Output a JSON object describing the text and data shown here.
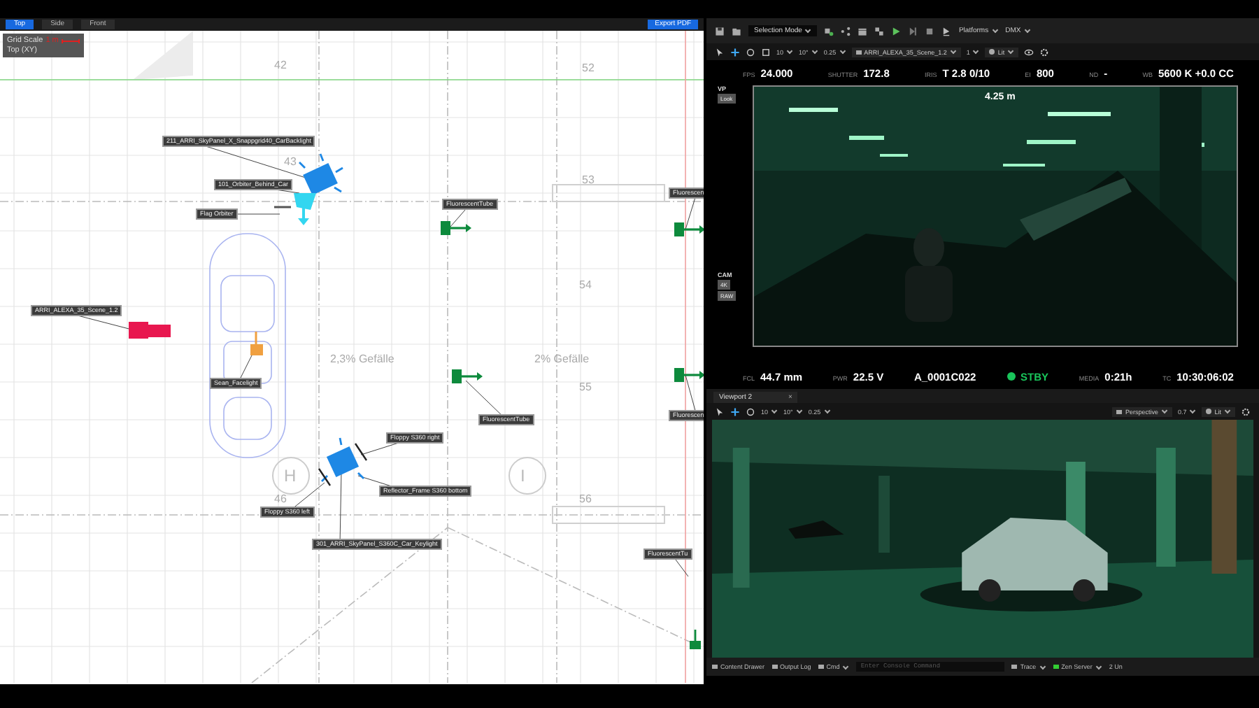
{
  "plan_view": {
    "tabs": [
      {
        "label": "Top",
        "selected": true
      },
      {
        "label": "Side",
        "selected": false
      },
      {
        "label": "Front",
        "selected": false
      }
    ],
    "export_button": "Export PDF",
    "grid_scale": {
      "label": "Grid Scale",
      "value": "1 m",
      "view": "Top (XY)"
    },
    "labels": [
      "211_ARRI_SkyPanel_X_Snappgrid40_CarBacklight",
      "101_Orbiter_Behind_Car",
      "Flag Orbiter",
      "FluorescentTube",
      "Fluorescen",
      "ARRI_ALEXA_35_Scene_1.2",
      "Sean_Facelight",
      "FluorescentTube",
      "Fluorescen",
      "Floppy S360 right",
      "Reflector_Frame S360 bottom",
      "Floppy S360 left",
      "301_ARRI_SkyPanel_S360C_Car_Keylight",
      "FluorescentTu"
    ],
    "plan_texts": [
      "52",
      "53",
      "54",
      "55",
      "56",
      "42",
      "43",
      "46",
      "2,3% Gefälle",
      "2% Gefälle"
    ],
    "axis_marks": [
      "H",
      "I"
    ]
  },
  "toolbar": {
    "mode": "Selection Mode",
    "platforms": "Platforms",
    "dmx": "DMX"
  },
  "viewport_1": {
    "camera": "ARRI_ALEXA_35_Scene_1.2",
    "snap_values": [
      "10",
      "10°",
      "0.25"
    ],
    "lit": "Lit",
    "layout": "1"
  },
  "camera_hud": {
    "top": [
      {
        "label": "FPS",
        "value": "24.000"
      },
      {
        "label": "SHUTTER",
        "value": "172.8"
      },
      {
        "label": "IRIS",
        "value": "T 2.8  0/10"
      },
      {
        "label": "EI",
        "value": "800"
      },
      {
        "label": "ND",
        "value": "-"
      },
      {
        "label": "WB",
        "value": "5600 K +0.0 CC"
      }
    ],
    "side": [
      {
        "heading": "VP",
        "buttons": [
          "Look"
        ]
      },
      {
        "heading": "CAM",
        "buttons": [
          "4K",
          "RAW"
        ]
      }
    ],
    "distance": "4.25 m",
    "bottom": [
      {
        "kind": "reading",
        "label": "FCL",
        "value": "44.7 mm"
      },
      {
        "kind": "reading",
        "label": "PWR",
        "value": "22.5 V"
      },
      {
        "kind": "clip",
        "value": "A_0001C022"
      },
      {
        "kind": "status",
        "value": "STBY"
      },
      {
        "kind": "reading",
        "label": "MEDIA",
        "value": "0:21h"
      },
      {
        "kind": "reading",
        "label": "TC",
        "value": "10:30:06:02"
      }
    ]
  },
  "viewport_2": {
    "tab": "Viewport 2",
    "close": "×",
    "snap_values": [
      "10",
      "10°",
      "0.25"
    ],
    "view": "Perspective",
    "speed": "0.7",
    "lit": "Lit"
  },
  "status_bar": {
    "buttons": [
      "Content Drawer",
      "Output Log"
    ],
    "cmd": "Cmd",
    "console_placeholder": "Enter Console Command",
    "trace": "Trace",
    "server": "Zen Server",
    "units": "2 Un"
  }
}
